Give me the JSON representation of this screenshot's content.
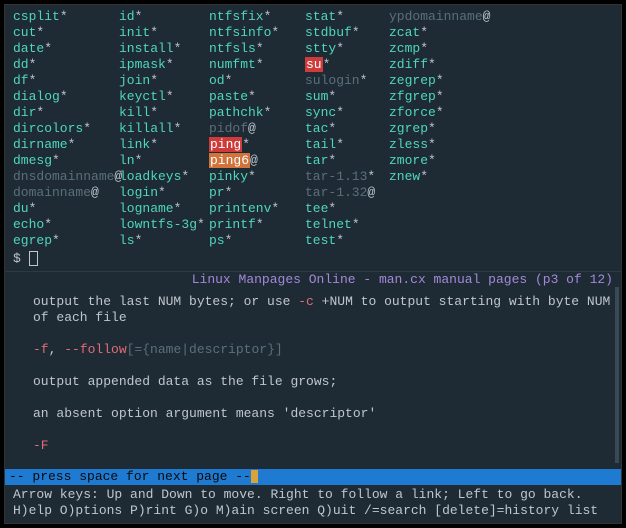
{
  "listing": {
    "columns": [
      [
        {
          "name": "csplit",
          "mark": "*"
        },
        {
          "name": "cut",
          "mark": "*"
        },
        {
          "name": "date",
          "mark": "*"
        },
        {
          "name": "dd",
          "mark": "*"
        },
        {
          "name": "df",
          "mark": "*"
        },
        {
          "name": "dialog",
          "mark": "*"
        },
        {
          "name": "dir",
          "mark": "*"
        },
        {
          "name": "dircolors",
          "mark": "*"
        },
        {
          "name": "dirname",
          "mark": "*"
        },
        {
          "name": "dmesg",
          "mark": "*"
        },
        {
          "name": "dnsdomainname",
          "mark": "@",
          "dim": true
        },
        {
          "name": "domainname",
          "mark": "@",
          "dim": true
        },
        {
          "name": "du",
          "mark": "*"
        },
        {
          "name": "echo",
          "mark": "*"
        },
        {
          "name": "egrep",
          "mark": "*"
        }
      ],
      [
        {
          "name": "id",
          "mark": "*"
        },
        {
          "name": "init",
          "mark": "*"
        },
        {
          "name": "install",
          "mark": "*"
        },
        {
          "name": "ipmask",
          "mark": "*"
        },
        {
          "name": "join",
          "mark": "*"
        },
        {
          "name": "keyctl",
          "mark": "*"
        },
        {
          "name": "kill",
          "mark": "*"
        },
        {
          "name": "killall",
          "mark": "*"
        },
        {
          "name": "link",
          "mark": "*"
        },
        {
          "name": "ln",
          "mark": "*"
        },
        {
          "name": "loadkeys",
          "mark": "*"
        },
        {
          "name": "login",
          "mark": "*"
        },
        {
          "name": "logname",
          "mark": "*"
        },
        {
          "name": "lowntfs-3g",
          "mark": "*"
        },
        {
          "name": "ls",
          "mark": "*"
        }
      ],
      [
        {
          "name": "ntfsfix",
          "mark": "*"
        },
        {
          "name": "ntfsinfo",
          "mark": "*"
        },
        {
          "name": "ntfsls",
          "mark": "*"
        },
        {
          "name": "numfmt",
          "mark": "*"
        },
        {
          "name": "od",
          "mark": "*"
        },
        {
          "name": "paste",
          "mark": "*"
        },
        {
          "name": "pathchk",
          "mark": "*"
        },
        {
          "name": "pidof",
          "mark": "@",
          "dim": true
        },
        {
          "name": "ping",
          "mark": "*",
          "hl": "red"
        },
        {
          "name": "ping6",
          "mark": "@",
          "hl": "org"
        },
        {
          "name": "pinky",
          "mark": "*"
        },
        {
          "name": "pr",
          "mark": "*"
        },
        {
          "name": "printenv",
          "mark": "*"
        },
        {
          "name": "printf",
          "mark": "*"
        },
        {
          "name": "ps",
          "mark": "*"
        }
      ],
      [
        {
          "name": "stat",
          "mark": "*"
        },
        {
          "name": "stdbuf",
          "mark": "*"
        },
        {
          "name": "stty",
          "mark": "*"
        },
        {
          "name": "su",
          "mark": "*",
          "hl": "red"
        },
        {
          "name": "sulogin",
          "mark": "*",
          "dim": true
        },
        {
          "name": "sum",
          "mark": "*"
        },
        {
          "name": "sync",
          "mark": "*"
        },
        {
          "name": "tac",
          "mark": "*"
        },
        {
          "name": "tail",
          "mark": "*"
        },
        {
          "name": "tar",
          "mark": "*"
        },
        {
          "name": "tar-1.13",
          "mark": "*",
          "dim": true
        },
        {
          "name": "tar-1.32",
          "mark": "@",
          "dim": true
        },
        {
          "name": "tee",
          "mark": "*"
        },
        {
          "name": "telnet",
          "mark": "*"
        },
        {
          "name": "test",
          "mark": "*"
        }
      ],
      [
        {
          "name": "ypdomainname",
          "mark": "@",
          "dim": true
        },
        {
          "name": "zcat",
          "mark": "*"
        },
        {
          "name": "zcmp",
          "mark": "*"
        },
        {
          "name": "zdiff",
          "mark": "*"
        },
        {
          "name": "zegrep",
          "mark": "*"
        },
        {
          "name": "zfgrep",
          "mark": "*"
        },
        {
          "name": "zforce",
          "mark": "*"
        },
        {
          "name": "zgrep",
          "mark": "*"
        },
        {
          "name": "zless",
          "mark": "*"
        },
        {
          "name": "zmore",
          "mark": "*"
        },
        {
          "name": "znew",
          "mark": "*"
        }
      ]
    ]
  },
  "prompt": {
    "symbol": "$"
  },
  "divider": {
    "text": "Linux Manpages Online - man.cx manual pages (p3 of 12)"
  },
  "man": {
    "p1a": "output the last NUM bytes; or use ",
    "p1flag": "-c",
    "p1b": " +NUM to output starting with byte NUM of each file",
    "p2flag1": "-f",
    "p2sep": ", ",
    "p2flag2": "--follow",
    "p2rest": "[={name|descriptor}]",
    "p3": "output appended data as the file grows;",
    "p4": "an absent option argument means 'descriptor'",
    "p5flag": "-F"
  },
  "status": {
    "text": "-- press space for next page --"
  },
  "help": {
    "l1": "Arrow keys: Up and Down to move.  Right to follow a link; Left to go back.",
    "l2": " H)elp O)ptions P)rint G)o M)ain screen Q)uit /=search [delete]=history list"
  }
}
